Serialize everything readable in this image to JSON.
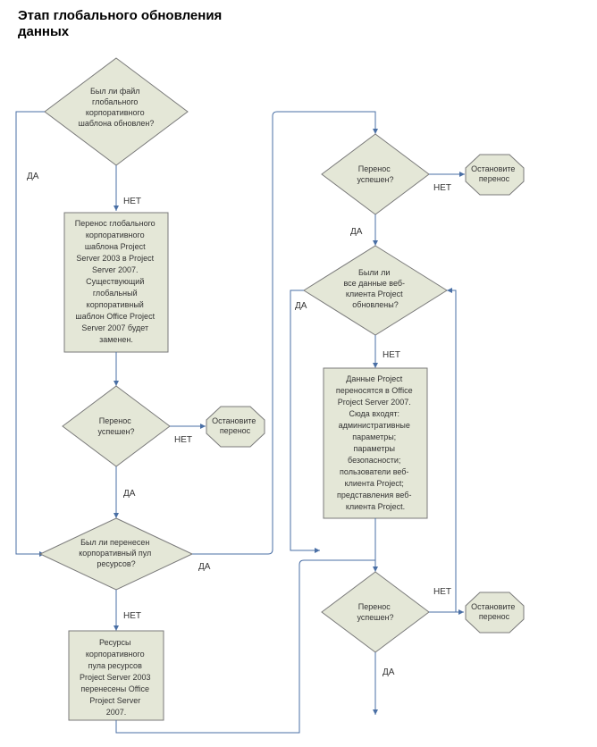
{
  "title": "Этап глобального обновления данных",
  "nodes": {
    "d1": {
      "lines": [
        "Был ли файл",
        "глобального",
        "корпоративного",
        "шаблона обновлен?"
      ]
    },
    "p1": {
      "lines": [
        "Перенос глобального",
        "корпоративного",
        "шаблона Project",
        "Server 2003 в Project",
        "Server 2007.",
        "Существующий",
        "глобальный",
        "корпоративный",
        "шаблон Office  Project",
        "Server 2007 будет",
        "заменен."
      ]
    },
    "d2": {
      "lines": [
        "Перенос",
        "успешен?"
      ]
    },
    "t1": {
      "lines": [
        "Остановите",
        "перенос"
      ]
    },
    "d3": {
      "lines": [
        "Был ли перенесен",
        "корпоративный пул",
        "ресурсов?"
      ]
    },
    "p2": {
      "lines": [
        "Ресурсы",
        "корпоративного",
        "пула ресурсов",
        "Project Server 2003",
        "перенесены Office",
        "Project Server",
        "2007."
      ]
    },
    "d4": {
      "lines": [
        "Перенос",
        "успешен?"
      ]
    },
    "t2": {
      "lines": [
        "Остановите",
        "перенос"
      ]
    },
    "d5": {
      "lines": [
        "Были ли",
        "все данные веб-",
        "клиента Project",
        "обновлены?"
      ]
    },
    "p3": {
      "lines": [
        "Данные Project",
        "переносятся в Office",
        "Project Server 2007.",
        "Сюда входят:",
        "административные",
        "параметры;",
        "параметры",
        "безопасности;",
        "пользователи веб-",
        "клиента Project;",
        "представления веб-",
        "клиента Project."
      ]
    },
    "d6": {
      "lines": [
        "Перенос",
        "успешен?"
      ]
    },
    "t3": {
      "lines": [
        "Остановите",
        "перенос"
      ]
    }
  },
  "edges": {
    "yes": "ДА",
    "no": "НЕТ"
  }
}
